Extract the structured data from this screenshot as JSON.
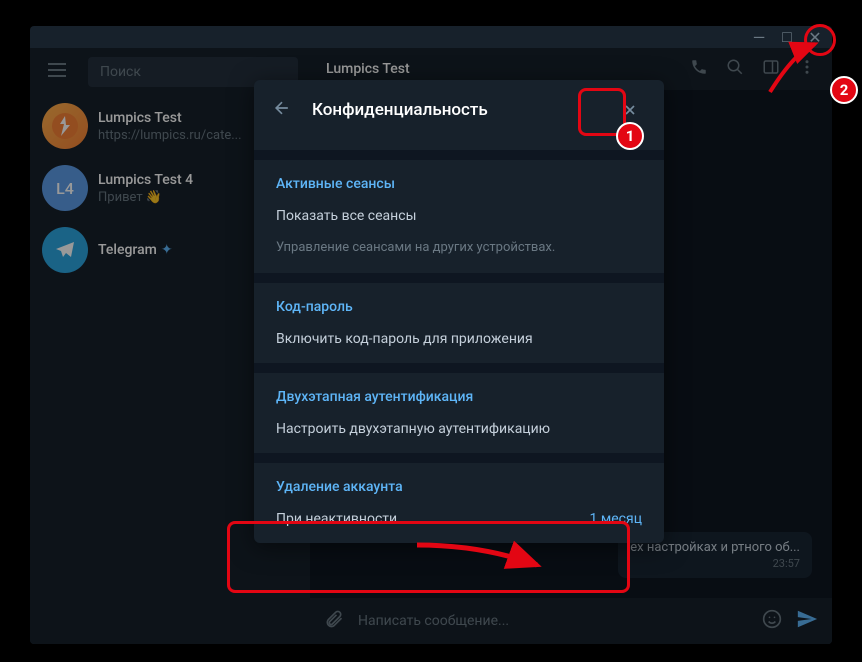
{
  "window": {
    "controls": {
      "min": "—",
      "max": "□",
      "close": "✕"
    }
  },
  "sidebar": {
    "search_placeholder": "Поиск",
    "chats": [
      {
        "name": "Lumpics Test",
        "preview": "https://lumpics.ru/cate...",
        "avatar_initials": "",
        "avatar_class": "orange"
      },
      {
        "name": "Lumpics Test 4",
        "preview": "Привет 👋",
        "avatar_initials": "L4",
        "avatar_class": "blue"
      },
      {
        "name": "Telegram",
        "preview": "",
        "avatar_initials": "",
        "avatar_class": "telegram",
        "verified": true
      }
    ]
  },
  "chat": {
    "title": "Lumpics Test",
    "message_snippet": "ех настройках и ртного об...",
    "message_time": "23:57",
    "composer_placeholder": "Написать сообщение..."
  },
  "modal": {
    "title": "Конфиденциальность",
    "truncated_top": "ех настройках и...",
    "sections": {
      "sessions": {
        "header": "Активные сеансы",
        "item": "Показать все сеансы",
        "desc": "Управление сеансами на других устройствах."
      },
      "passcode": {
        "header": "Код-пароль",
        "item": "Включить код-пароль для приложения"
      },
      "two_step": {
        "header": "Двухэтапная аутентификация",
        "item": "Настроить двухэтапную аутентификацию"
      },
      "delete": {
        "header": "Удаление аккаунта",
        "item": "При неактивности...",
        "value": "1 месяц"
      }
    }
  },
  "badges": {
    "b1": "1",
    "b2": "2"
  }
}
